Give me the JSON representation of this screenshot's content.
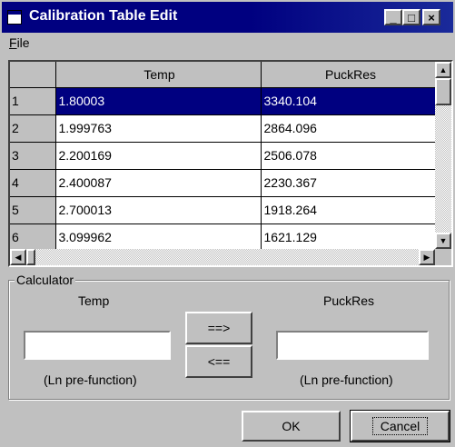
{
  "window": {
    "title": "Calibration Table Edit",
    "controls": {
      "minimize": "_",
      "maximize": "□",
      "close": "×"
    }
  },
  "menu": {
    "file_label": "File"
  },
  "grid": {
    "columns": [
      "Temp",
      "PuckRes"
    ],
    "rows": [
      {
        "index": "1",
        "temp": "1.80003",
        "puckres": "3340.104",
        "selected": true
      },
      {
        "index": "2",
        "temp": "1.999763",
        "puckres": "2864.096"
      },
      {
        "index": "3",
        "temp": "2.200169",
        "puckres": "2506.078"
      },
      {
        "index": "4",
        "temp": "2.400087",
        "puckres": "2230.367"
      },
      {
        "index": "5",
        "temp": "2.700013",
        "puckres": "1918.264"
      },
      {
        "index": "6",
        "temp": "3.099962",
        "puckres": "1621.129"
      }
    ]
  },
  "calculator": {
    "group_label": "Calculator",
    "left_label": "Temp",
    "right_label": "PuckRes",
    "left_value": "",
    "right_value": "",
    "left_note": "(Ln pre-function)",
    "right_note": "(Ln pre-function)",
    "to_right_label": "==>",
    "to_left_label": "<=="
  },
  "footer": {
    "ok_label": "OK",
    "cancel_label": "Cancel"
  },
  "icons": {
    "scroll_up": "▲",
    "scroll_down": "▼",
    "scroll_left": "◀",
    "scroll_right": "▶"
  },
  "colors": {
    "title_bar": "#000080",
    "selection": "#000080",
    "face": "#c0c0c0"
  }
}
